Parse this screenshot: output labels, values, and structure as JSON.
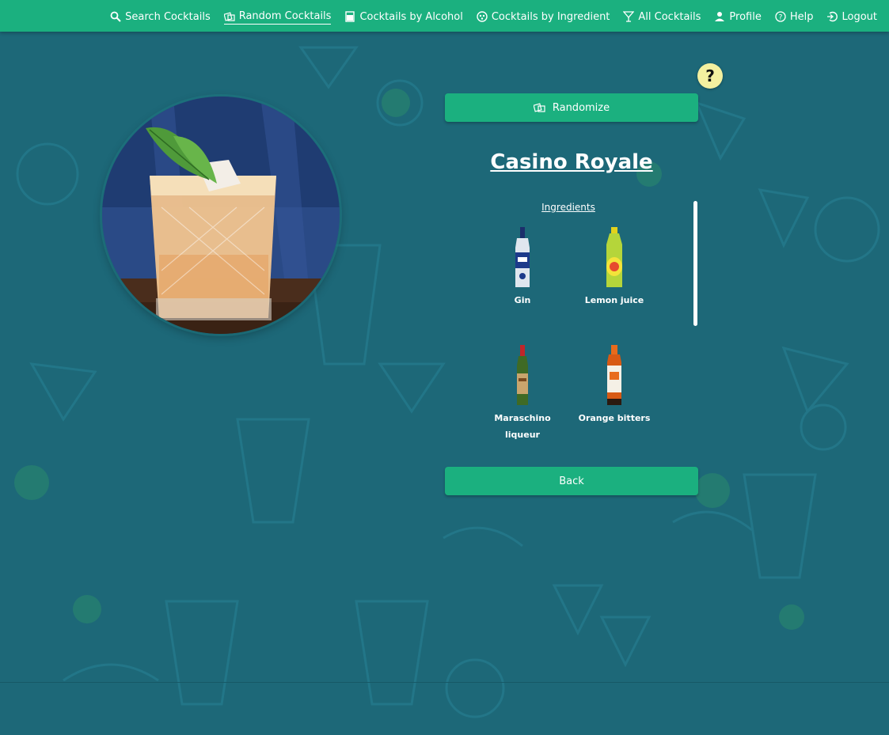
{
  "nav": {
    "items": [
      {
        "label": "Search Cocktails",
        "icon": "search-icon",
        "active": false
      },
      {
        "label": "Random Cocktails",
        "icon": "dice-icon",
        "active": true
      },
      {
        "label": "Cocktails by Alcohol",
        "icon": "glass-icon",
        "active": false
      },
      {
        "label": "Cocktails by Ingredient",
        "icon": "ingredient-icon",
        "active": false
      },
      {
        "label": "All Cocktails",
        "icon": "cocktail-icon",
        "active": false
      },
      {
        "label": "Profile",
        "icon": "user-icon",
        "active": false
      },
      {
        "label": "Help",
        "icon": "help-circle-icon",
        "active": false
      },
      {
        "label": "Logout",
        "icon": "logout-icon",
        "active": false
      }
    ]
  },
  "help": {
    "label": "?"
  },
  "randomize": {
    "label": "Randomize",
    "icon": "dice-icon"
  },
  "cocktail": {
    "name": "Casino Royale",
    "ingredients_title": "Ingredients",
    "ingredients": [
      {
        "name": "Gin",
        "icon": "gin-bottle-icon"
      },
      {
        "name": "Lemon juice",
        "icon": "lemon-juice-bottle-icon"
      },
      {
        "name": "Maraschino liqueur",
        "icon": "maraschino-bottle-icon"
      },
      {
        "name": "Orange bitters",
        "icon": "orange-bitters-bottle-icon"
      }
    ]
  },
  "back": {
    "label": "Back"
  },
  "colors": {
    "navbar": "#1bb07f",
    "background": "#1d6878",
    "button": "#1bb07f",
    "help_button": "#f3f0a0"
  }
}
